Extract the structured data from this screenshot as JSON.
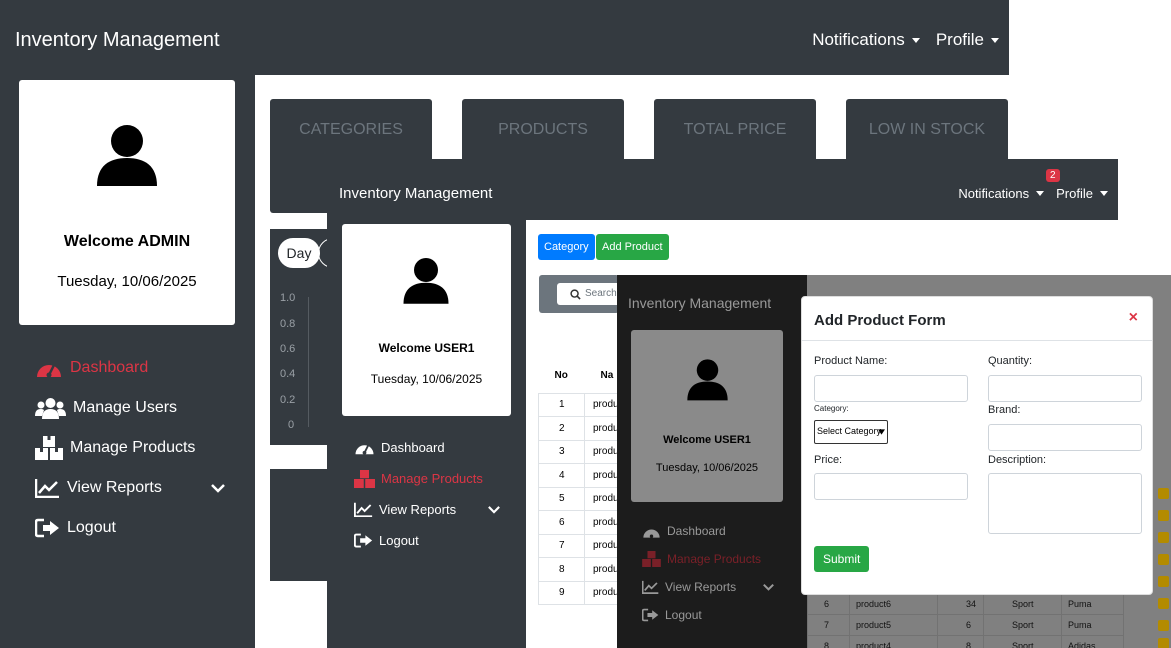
{
  "admin_window": {
    "app_title": "Inventory Management",
    "nav": {
      "notifications": "Notifications",
      "profile": "Profile"
    },
    "user_card": {
      "welcome": "Welcome ADMIN",
      "date": "Tuesday, 10/06/2025"
    },
    "menu": [
      {
        "label": "Dashboard",
        "icon": "dashboard-icon",
        "active": true
      },
      {
        "label": "Manage Users",
        "icon": "users-icon",
        "active": false
      },
      {
        "label": "Manage Products",
        "icon": "boxes-icon",
        "active": false
      },
      {
        "label": "View Reports",
        "icon": "chart-line-icon",
        "active": false
      },
      {
        "label": "Logout",
        "icon": "logout-icon",
        "active": false
      }
    ],
    "stats": [
      {
        "label": "CATEGORIES",
        "value": ""
      },
      {
        "label": "PRODUCTS",
        "value": ""
      },
      {
        "label": "TOTAL PRICE",
        "value": ""
      },
      {
        "label": "LOW IN STOCK",
        "value": ""
      }
    ],
    "chart": {
      "range_button": "Day",
      "yticks": [
        "1.0",
        "0.8",
        "0.6",
        "0.4",
        "0.2",
        "0"
      ]
    }
  },
  "user1_window": {
    "app_title": "Inventory Management",
    "nav": {
      "notifications": "Notifications",
      "notification_count": "2",
      "profile": "Profile"
    },
    "user_card": {
      "welcome": "Welcome USER1",
      "date": "Tuesday, 10/06/2025"
    },
    "menu": [
      {
        "label": "Dashboard",
        "icon": "dashboard-icon",
        "active": false
      },
      {
        "label": "Manage Products",
        "icon": "boxes-icon",
        "active": true
      },
      {
        "label": "View Reports",
        "icon": "chart-line-icon",
        "active": false
      },
      {
        "label": "Logout",
        "icon": "logout-icon",
        "active": false
      }
    ],
    "buttons": {
      "category": "Category",
      "add_product": "Add Product"
    },
    "search_placeholder": "Search",
    "table": {
      "headers": [
        "No",
        "Na"
      ],
      "rows": [
        [
          "1",
          "product"
        ],
        [
          "2",
          "product"
        ],
        [
          "3",
          "product"
        ],
        [
          "4",
          "product"
        ],
        [
          "5",
          "product"
        ],
        [
          "6",
          "product"
        ],
        [
          "7",
          "product"
        ],
        [
          "8",
          "product"
        ],
        [
          "9",
          "product"
        ]
      ]
    }
  },
  "modal_window": {
    "app_title": "Inventory Management",
    "user_card": {
      "welcome": "Welcome USER1",
      "date": "Tuesday, 10/06/2025"
    },
    "menu": [
      {
        "label": "Dashboard",
        "icon": "dashboard-icon",
        "active": false
      },
      {
        "label": "Manage Products",
        "icon": "boxes-icon",
        "active": true
      },
      {
        "label": "View Reports",
        "icon": "chart-line-icon",
        "active": false
      },
      {
        "label": "Logout",
        "icon": "logout-icon",
        "active": false
      }
    ],
    "table_rows": [
      [
        "6",
        "product6",
        "34",
        "Sport",
        "Puma"
      ],
      [
        "7",
        "product5",
        "6",
        "Sport",
        "Puma"
      ],
      [
        "8",
        "product4",
        "8",
        "Sport",
        "Adidas"
      ]
    ],
    "form": {
      "title": "Add Product Form",
      "close": "×",
      "product_name_label": "Product Name:",
      "quantity_label": "Quantity:",
      "category_label": "Category:",
      "category_selected": "Select Category",
      "brand_label": "Brand:",
      "price_label": "Price:",
      "description_label": "Description:",
      "submit": "Submit"
    }
  }
}
